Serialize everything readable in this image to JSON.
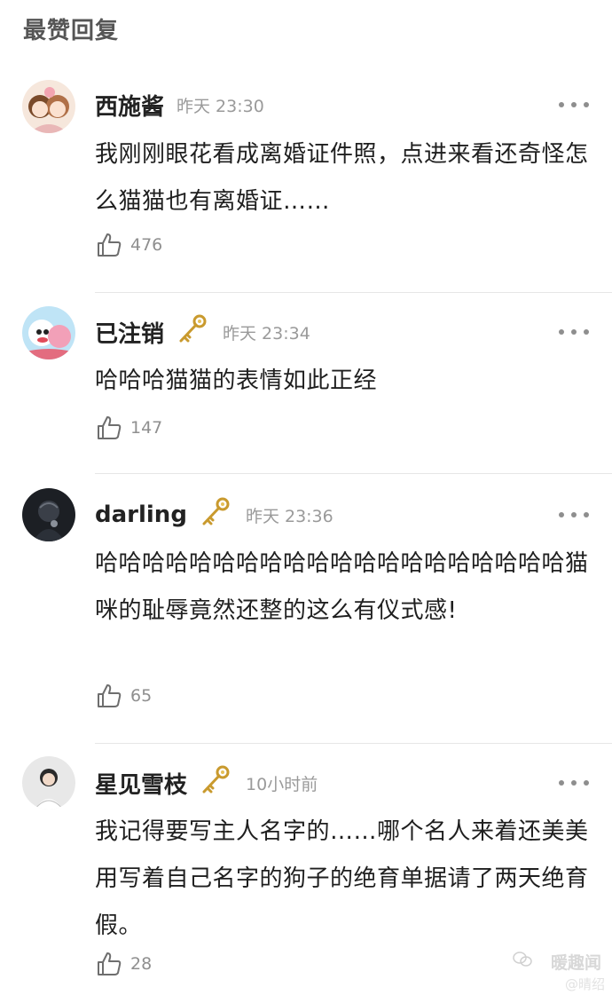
{
  "section_title": "最赞回复",
  "comments": [
    {
      "username": "西施酱",
      "time": "昨天 23:30",
      "text": "我刚刚眼花看成离婚证件照，点进来看还奇怪怎么猫猫也有离婚证……",
      "likes": "476",
      "has_badge": false
    },
    {
      "username": "已注销",
      "time": "昨天 23:34",
      "text": "哈哈哈猫猫的表情如此正经",
      "likes": "147",
      "has_badge": true
    },
    {
      "username": "darling",
      "time": "昨天 23:36",
      "text": "哈哈哈哈哈哈哈哈哈哈哈哈哈哈哈哈哈哈哈哈猫咪的耻辱竟然还整的这么有仪式感!",
      "likes": "65",
      "has_badge": true
    },
    {
      "username": "星见雪枝",
      "time": "10小时前",
      "text": "我记得要写主人名字的……哪个名人来着还美美用写着自己名字的狗子的绝育单据请了两天绝育假。",
      "likes": "28",
      "has_badge": true
    }
  ],
  "watermark": {
    "main": "暖趣闻",
    "sub": "@晴绍"
  },
  "colors": {
    "username": "#222222",
    "time": "#9a9a9a",
    "badge_gold": "#c99a2e",
    "divider": "#e6e6e6"
  },
  "icons": {
    "badge": "golden-key-icon",
    "like": "thumbs-up-icon",
    "more": "more-dots-icon"
  }
}
